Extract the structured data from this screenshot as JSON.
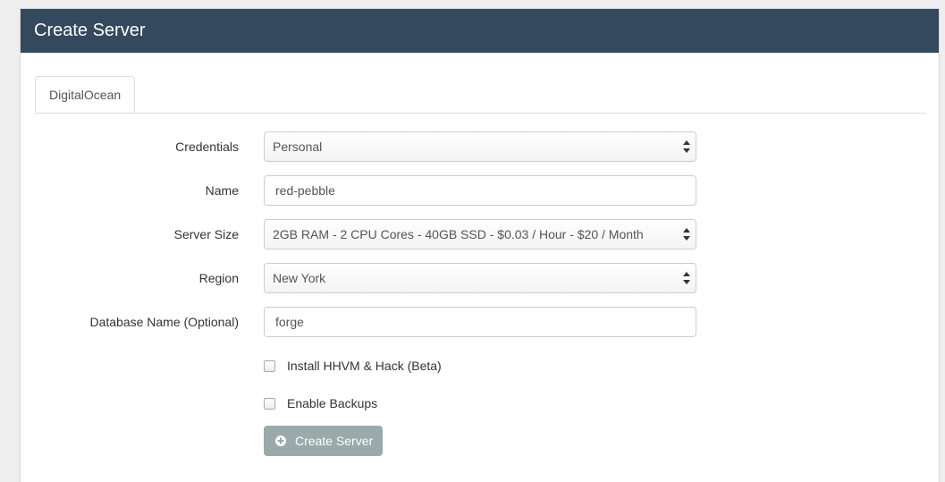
{
  "panel": {
    "title": "Create Server"
  },
  "tabs": [
    {
      "label": "DigitalOcean",
      "active": true
    }
  ],
  "form": {
    "credentials": {
      "label": "Credentials",
      "value": "Personal"
    },
    "name": {
      "label": "Name",
      "value": "red-pebble"
    },
    "server_size": {
      "label": "Server Size",
      "value": "2GB RAM - 2 CPU Cores - 40GB SSD - $0.03 / Hour - $20 / Month"
    },
    "region": {
      "label": "Region",
      "value": "New York"
    },
    "database_name": {
      "label": "Database Name (Optional)",
      "value": "forge"
    },
    "install_hhvm": {
      "label": "Install HHVM & Hack (Beta)",
      "checked": false
    },
    "enable_backups": {
      "label": "Enable Backups",
      "checked": false
    },
    "submit": {
      "label": "Create Server",
      "icon": "plus-circle-icon"
    }
  },
  "colors": {
    "header_bg": "#34495e",
    "button_bg": "#95a5a6"
  }
}
